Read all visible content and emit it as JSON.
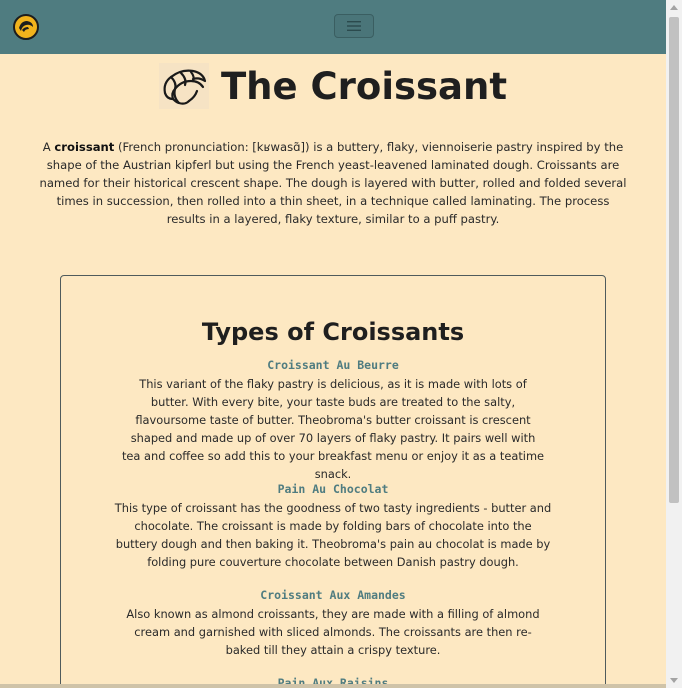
{
  "nav": {
    "logo_icon": "croissant-logo-icon",
    "toggler_icon": "hamburger-menu-icon",
    "background": "#4f7c80"
  },
  "header": {
    "title": "The Croissant",
    "title_icon": "croissant-icon"
  },
  "intro": {
    "lead": "A ",
    "bold_term": "croissant",
    "text": " (French pronunciation: [kʁwasɑ̃]) is a buttery, flaky, viennoiserie pastry inspired by the shape of the Austrian kipferl but using the French yeast-leavened laminated dough. Croissants are named for their historical crescent shape. The dough is layered with butter, rolled and folded several times in succession, then rolled into a thin sheet, in a technique called laminating. The process results in a layered, flaky texture, similar to a puff pastry."
  },
  "types": {
    "heading": "Types of Croissants",
    "items": [
      {
        "name": "Croissant Au Beurre",
        "description": "This variant of the flaky pastry is delicious, as it is made with lots of butter. With every bite, your taste buds are treated to the salty, flavoursome taste of butter. Theobroma's butter croissant is crescent shaped and made up of over 70 layers of flaky pastry. It pairs well with tea and coffee so add this to your breakfast menu or enjoy it as a teatime snack."
      },
      {
        "name": "Pain Au Chocolat",
        "description": "This type of croissant has the goodness of two tasty ingredients - butter and chocolate. The croissant is made by folding bars of chocolate into the buttery dough and then baking it. Theobroma's pain au chocolat is made by folding pure couverture chocolate between Danish pastry dough."
      },
      {
        "name": "Croissant Aux Amandes",
        "description": "Also known as almond croissants, they are made with a filling of almond cream and garnished with sliced almonds. The croissants are then re-baked till they attain a crispy texture."
      },
      {
        "name": "Pain Aux Raisins",
        "description": ""
      }
    ]
  },
  "colors": {
    "page_background": "#fde8c2",
    "accent": "#4f7c80",
    "text": "#1f1f1f"
  }
}
